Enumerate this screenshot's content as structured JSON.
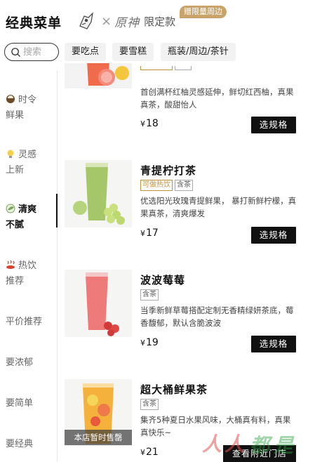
{
  "header": {
    "title": "经典菜单",
    "collab_mark": "×",
    "collab_brand": "原神",
    "collab_limit": "限定款",
    "gift_badge": "赠限量周边"
  },
  "search": {
    "placeholder": "搜索"
  },
  "chips": [
    "要吃点",
    "要雪糕",
    "瓶装/周边/茶针"
  ],
  "sidebar": {
    "items": [
      {
        "line1": "时令",
        "line2": "鲜果",
        "icon": "coconut-icon"
      },
      {
        "line1": "灵感",
        "line2": "上新",
        "icon": "lightbulb-icon"
      },
      {
        "line1": "清爽",
        "line2": "不腻",
        "icon": "leaf-icon",
        "active": true
      },
      {
        "line1": "热饮",
        "line2": "推荐",
        "icon": "hot-spring-icon"
      },
      {
        "line1": "平价推荐",
        "line2": ""
      },
      {
        "line1": "要浓郁",
        "line2": ""
      },
      {
        "line1": "要简单",
        "line2": ""
      },
      {
        "line1": "要经典",
        "line2": ""
      }
    ]
  },
  "products": [
    {
      "name": "",
      "tags": [],
      "desc": "首创满杯红柚灵感延伸，鲜切红西柚，真果真茶，酸甜怡人",
      "currency": "¥",
      "price": "18",
      "button": "选规格"
    },
    {
      "name": "青提柠打茶",
      "tags": [
        "可做热饮",
        "含茶"
      ],
      "desc": "优选阳光玫瑰青提鲜果， 暴打新鲜柠檬，真果真茶，清爽爆发",
      "currency": "¥",
      "price": "17",
      "button": "选规格"
    },
    {
      "name": "波波莓莓",
      "tags": [
        "含茶"
      ],
      "desc": "当季新鲜草莓搭配定制无香精绿妍茶底，莓香馥郁，默认含脆波波",
      "currency": "¥",
      "price": "19",
      "button": "选规格"
    },
    {
      "name": "超大桶鲜果茶",
      "tags": [
        "含茶"
      ],
      "desc": "集齐5种夏日水果风味，大桶真有料，真果真快乐~",
      "currency": "¥",
      "price": "21",
      "soldout": "本店暂时售罄",
      "button": "查看附近门店"
    }
  ],
  "watermark": {
    "a": "人人",
    "b": "都是",
    "c": "产品经理"
  },
  "colors": {
    "accent": "#111111",
    "gold": "#c8a46a",
    "tag_warm": "#c0913f"
  }
}
